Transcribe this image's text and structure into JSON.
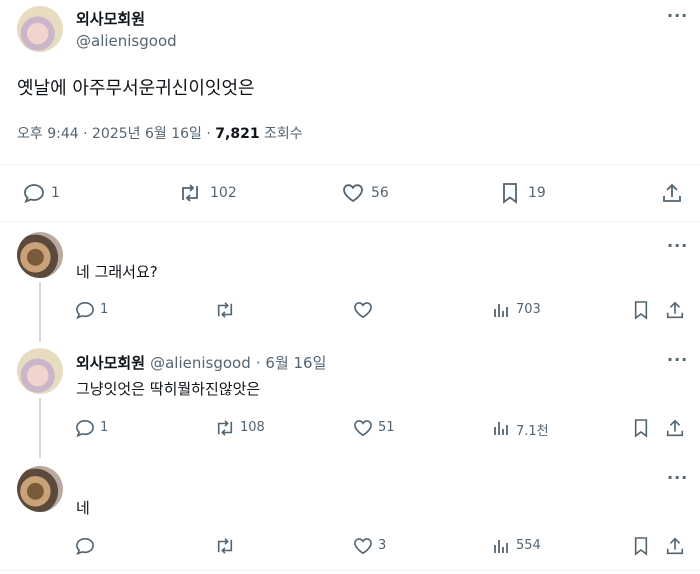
{
  "main_post": {
    "name": "외사모회원",
    "handle": "@alienisgood",
    "text": "옛날에 아주무서운귀신이잇엇은",
    "time": "오후 9:44",
    "date": "2025년 6월 16일",
    "views": "7,821",
    "views_label": "조회수",
    "replies": "1",
    "reposts": "102",
    "likes": "56",
    "bookmarks": "19"
  },
  "replies": [
    {
      "text": "네 그래서요?",
      "replies": "1",
      "reposts": "",
      "likes": "",
      "views": "703"
    },
    {
      "name": "외사모회원",
      "handle": "@alienisgood",
      "date": "6월 16일",
      "text": "그냥잇엇은 딱히뭘하진않앗은",
      "replies": "1",
      "reposts": "108",
      "likes": "51",
      "views": "7.1천"
    },
    {
      "text": "네",
      "replies": "",
      "reposts": "",
      "likes": "3",
      "views": "554"
    }
  ],
  "icons": [
    "more-icon",
    "reply-icon",
    "repost-icon",
    "like-icon",
    "bookmark-icon",
    "share-icon",
    "views-icon"
  ],
  "colors": {
    "text": "#0f1419",
    "secondary": "#536471",
    "divider": "#eff3f4"
  }
}
